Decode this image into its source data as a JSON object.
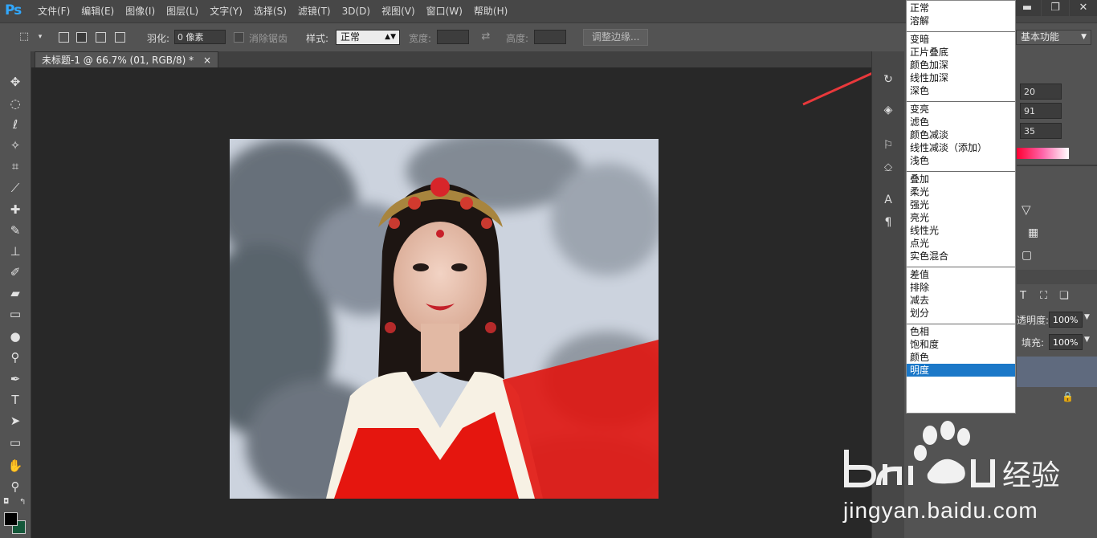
{
  "app": {
    "logo": "Ps"
  },
  "menu": [
    "文件(F)",
    "编辑(E)",
    "图像(I)",
    "图层(L)",
    "文字(Y)",
    "选择(S)",
    "滤镜(T)",
    "3D(D)",
    "视图(V)",
    "窗口(W)",
    "帮助(H)"
  ],
  "window_controls": {
    "minimize": "▬",
    "restore": "❐",
    "close": "✕"
  },
  "options": {
    "feather_label": "羽化:",
    "feather_value": "0 像素",
    "antialias_label": "消除锯齿",
    "style_label": "样式:",
    "style_value": "正常",
    "width_label": "宽度:",
    "height_label": "高度:",
    "refine_edge_label": "调整边缘...",
    "workspace_value": "基本功能"
  },
  "document": {
    "tab_title": "未标题-1 @ 66.7% (01, RGB/8) *",
    "tab_close": "×"
  },
  "color_panel": {
    "r": "20",
    "g": "91",
    "b": "35"
  },
  "layers_panel": {
    "opacity_label": "透明度:",
    "opacity_value": "100%",
    "fill_label": "填充:",
    "fill_value": "100%"
  },
  "blend_modes": [
    [
      "正常",
      "溶解"
    ],
    [
      "变暗",
      "正片叠底",
      "颜色加深",
      "线性加深",
      "深色"
    ],
    [
      "变亮",
      "滤色",
      "颜色减淡",
      "线性减淡（添加）",
      "浅色"
    ],
    [
      "叠加",
      "柔光",
      "强光",
      "亮光",
      "线性光",
      "点光",
      "实色混合"
    ],
    [
      "差值",
      "排除",
      "减去",
      "划分"
    ],
    [
      "色相",
      "饱和度",
      "颜色",
      "明度"
    ]
  ],
  "selected_blend_mode": "明度",
  "watermark": {
    "text": "jingyan.baidu.com"
  },
  "colors": {
    "accent": "#1b78c8",
    "arrow": "#e8383b",
    "foreground": "#000000",
    "background": "#14583a"
  }
}
